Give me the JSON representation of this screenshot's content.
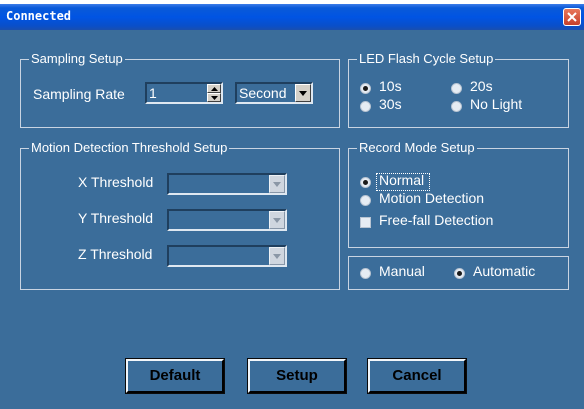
{
  "window": {
    "title": "Connected"
  },
  "sampling": {
    "legend": "Sampling Setup",
    "rate_label": "Sampling Rate",
    "rate_value": "1",
    "unit_value": "Second"
  },
  "led": {
    "legend": "LED Flash Cycle Setup",
    "options": [
      {
        "label": "10s",
        "selected": true
      },
      {
        "label": "20s",
        "selected": false
      },
      {
        "label": "30s",
        "selected": false
      },
      {
        "label": "No Light",
        "selected": false
      }
    ]
  },
  "motion": {
    "legend": "Motion Detection Threshold Setup",
    "x_label": "X Threshold",
    "y_label": "Y Threshold",
    "z_label": "Z Threshold",
    "x_value": "",
    "y_value": "",
    "z_value": ""
  },
  "record": {
    "legend": "Record Mode Setup",
    "normal_label": "Normal",
    "normal_selected": true,
    "motion_label": "Motion Detection",
    "motion_selected": false,
    "freefall_label": "Free-fall Detection",
    "freefall_checked": false
  },
  "mode": {
    "manual_label": "Manual",
    "manual_selected": false,
    "automatic_label": "Automatic",
    "automatic_selected": true
  },
  "buttons": {
    "default_label": "Default",
    "setup_label": "Setup",
    "cancel_label": "Cancel"
  },
  "colors": {
    "title_bar": "#0054e3",
    "dialog_bg": "#3b6d9a",
    "close_button": "#d9532f"
  },
  "icons": {
    "close": "close-icon",
    "spin_up": "spin-up-icon",
    "spin_down": "spin-down-icon",
    "dropdown": "chevron-down-icon"
  }
}
